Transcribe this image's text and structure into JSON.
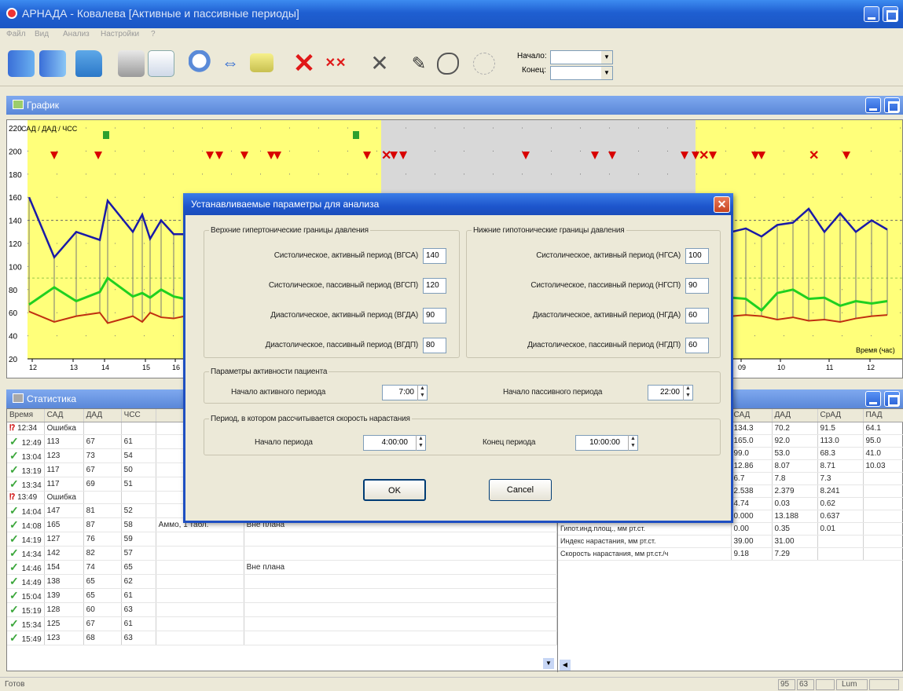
{
  "app": {
    "title": "АРНАДА - Ковалева [Активные и пассивные периоды]"
  },
  "menu": [
    "Файл",
    "Вид",
    "Анализ",
    "Настройки",
    "?"
  ],
  "toolbar": {
    "start_label": "Начало:",
    "end_label": "Конец:",
    "icons": [
      "records-icon",
      "records-alt-icon",
      "open-folder-icon",
      "print-icon",
      "print-preview-icon",
      "zoom-icon",
      "pan-arrows-icon",
      "comment-icon",
      "delete-cross-icon",
      "delete-range-icon",
      "tools-icon",
      "pen-icon",
      "shape-icon",
      "disabled-target-icon"
    ]
  },
  "chart_window": {
    "title": "График"
  },
  "chart_data": {
    "type": "line",
    "title": "",
    "ylabel": "САД / ДАД / ЧСС",
    "xlabel": "Время (час)",
    "ylim": [
      20,
      220
    ],
    "yticks": [
      "220",
      "200",
      "180",
      "160",
      "140",
      "120",
      "100",
      "80",
      "60",
      "40",
      "20"
    ],
    "xticks": [
      "12",
      "13",
      "14",
      "15",
      "16",
      "09",
      "10",
      "11",
      "12"
    ],
    "grid": true,
    "passive_shaded": true,
    "colors": {
      "sad": "#1a1aa8",
      "dad": "#20d020",
      "chss": "#c03010",
      "active_bg": "#ffff7a",
      "passive_bg": "#d8d8d8",
      "marker": "#d80000"
    },
    "series": [
      {
        "values_left": [
          160,
          108,
          130,
          123,
          157,
          130,
          145,
          124,
          140,
          128,
          128,
          140
        ]
      },
      {
        "values_left": [
          67,
          82,
          70,
          78,
          90,
          74,
          77,
          73,
          80,
          74,
          72,
          76
        ]
      },
      {
        "values_left": [
          61,
          52,
          57,
          60,
          51,
          57,
          52,
          60,
          56,
          55,
          57,
          58
        ]
      },
      {
        "values_right": [
          130,
          133,
          126,
          136,
          138,
          150,
          130,
          146,
          130,
          140,
          132
        ]
      },
      {
        "values_right": [
          73,
          72,
          62,
          77,
          80,
          72,
          73,
          66,
          70,
          68,
          70
        ]
      },
      {
        "values_right": [
          57,
          58,
          57,
          54,
          56,
          53,
          54,
          52,
          55,
          57,
          58
        ]
      }
    ]
  },
  "stats_window": {
    "title": "Статистика"
  },
  "stats_table": {
    "headers": [
      "Время",
      "САД",
      "ДАД",
      "ЧСС",
      "",
      ""
    ],
    "rows": [
      {
        "status": "error",
        "time": "12:34",
        "sad": "Ошибка",
        "dad": "",
        "chss": "",
        "note1": "",
        "note2": ""
      },
      {
        "status": "ok",
        "time": "12:49",
        "sad": "113",
        "dad": "67",
        "chss": "61",
        "note1": "",
        "note2": ""
      },
      {
        "status": "ok",
        "time": "13:04",
        "sad": "123",
        "dad": "73",
        "chss": "54",
        "note1": "",
        "note2": ""
      },
      {
        "status": "ok",
        "time": "13:19",
        "sad": "117",
        "dad": "67",
        "chss": "50",
        "note1": "",
        "note2": ""
      },
      {
        "status": "ok",
        "time": "13:34",
        "sad": "117",
        "dad": "69",
        "chss": "51",
        "note1": "",
        "note2": ""
      },
      {
        "status": "error",
        "time": "13:49",
        "sad": "Ошибка",
        "dad": "",
        "chss": "",
        "note1": "",
        "note2": ""
      },
      {
        "status": "ok",
        "time": "14:04",
        "sad": "147",
        "dad": "81",
        "chss": "52",
        "note1": "",
        "note2": ""
      },
      {
        "status": "ok",
        "time": "14:08",
        "sad": "165",
        "dad": "87",
        "chss": "58",
        "note1": "Аммо, 1 табл.",
        "note2": "Вне плана"
      },
      {
        "status": "ok",
        "time": "14:19",
        "sad": "127",
        "dad": "76",
        "chss": "59",
        "note1": "",
        "note2": ""
      },
      {
        "status": "ok",
        "time": "14:34",
        "sad": "142",
        "dad": "82",
        "chss": "57",
        "note1": "",
        "note2": ""
      },
      {
        "status": "ok",
        "time": "14:46",
        "sad": "154",
        "dad": "74",
        "chss": "65",
        "note1": "",
        "note2": "Вне плана"
      },
      {
        "status": "ok",
        "time": "14:49",
        "sad": "138",
        "dad": "65",
        "chss": "62",
        "note1": "",
        "note2": ""
      },
      {
        "status": "ok",
        "time": "15:04",
        "sad": "139",
        "dad": "65",
        "chss": "61",
        "note1": "",
        "note2": ""
      },
      {
        "status": "ok",
        "time": "15:19",
        "sad": "128",
        "dad": "60",
        "chss": "63",
        "note1": "",
        "note2": ""
      },
      {
        "status": "ok",
        "time": "15:34",
        "sad": "125",
        "dad": "67",
        "chss": "61",
        "note1": "",
        "note2": ""
      },
      {
        "status": "ok",
        "time": "15:49",
        "sad": "123",
        "dad": "68",
        "chss": "63",
        "note1": "",
        "note2": ""
      }
    ]
  },
  "summary_table": {
    "headers": [
      "",
      "САД",
      "ДАД",
      "СрАД",
      "ПАД"
    ],
    "rows": [
      [
        "",
        "134.3",
        "70.2",
        "91.5",
        "64.1"
      ],
      [
        "",
        "165.0",
        "92.0",
        "113.0",
        "95.0"
      ],
      [
        "",
        "99.0",
        "53.0",
        "68.3",
        "41.0"
      ],
      [
        "",
        "12.86",
        "8.07",
        "8.71",
        "10.03"
      ],
      [
        "",
        "6.7",
        "7.8",
        "7.3",
        ""
      ],
      [
        "",
        "2.538",
        "2.379",
        "8.241",
        ""
      ],
      [
        "",
        "4.74",
        "0.03",
        "0.62",
        ""
      ],
      [
        "Гипот.инд.врем, %",
        "0.000",
        "13.188",
        "0.637",
        ""
      ],
      [
        "Гипот.инд.площ., мм рт.ст.",
        "0.00",
        "0.35",
        "0.01",
        ""
      ],
      [
        "Индекс нарастания, мм рт.ст.",
        "39.00",
        "31.00",
        "",
        ""
      ],
      [
        "Скорость нарастания, мм рт.ст./ч",
        "9.18",
        "7.29",
        "",
        ""
      ]
    ]
  },
  "dialog": {
    "title": "Устанавливаемые параметры для анализа",
    "upper_group": "Верхние гипертонические границы давления",
    "lower_group": "Нижние гипотонические границы давления",
    "upper_fields": [
      {
        "label": "Систолическое, активный период (ВГСА)",
        "value": "140"
      },
      {
        "label": "Систолическое, пассивный период (ВГСП)",
        "value": "120"
      },
      {
        "label": "Диастолическое, активный период (ВГДА)",
        "value": "90"
      },
      {
        "label": "Диастолическое, пассивный период (ВГДП)",
        "value": "80"
      }
    ],
    "lower_fields": [
      {
        "label": "Систолическое, активный период (НГСА)",
        "value": "100"
      },
      {
        "label": "Систолическое, пассивный период (НГСП)",
        "value": "90"
      },
      {
        "label": "Диастолическое, активный период (НГДА)",
        "value": "60"
      },
      {
        "label": "Диастолическое, пассивный период (НГДП)",
        "value": "60"
      }
    ],
    "activity_group": "Параметры активности пациента",
    "active_start_label": "Начало активного периода",
    "active_start_value": "7:00",
    "passive_start_label": "Начало пассивного периода",
    "passive_start_value": "22:00",
    "rate_group": "Период, в котором рассчитывается скорость нарастания",
    "rate_start_label": "Начало периода",
    "rate_start_value": "4:00:00",
    "rate_end_label": "Конец периода",
    "rate_end_value": "10:00:00",
    "ok_label": "OK",
    "cancel_label": "Cancel"
  },
  "statusbar": {
    "left": "Готов",
    "cells": [
      "95",
      "63",
      "",
      "Lum",
      ""
    ]
  }
}
